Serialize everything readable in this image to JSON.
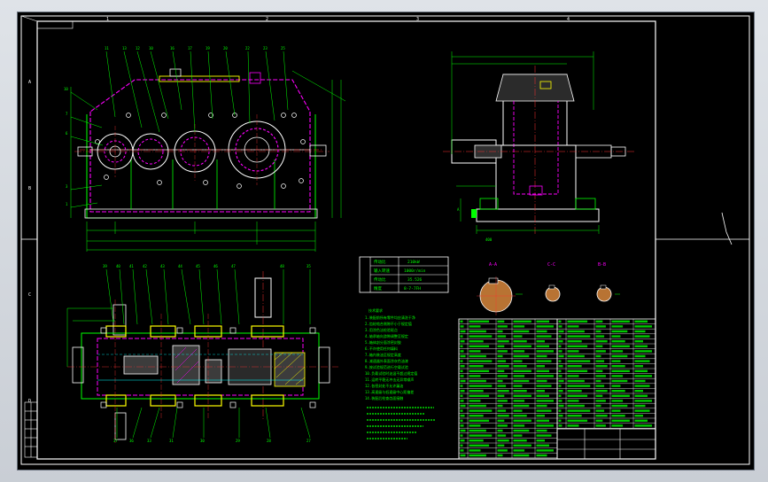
{
  "sheet": {
    "zone_numbers_top": [
      "1",
      "2",
      "3",
      "4"
    ],
    "zone_letters_side": [
      "A",
      "B",
      "C",
      "D"
    ]
  },
  "tech_table": {
    "rows": [
      {
        "label": "传动比",
        "value": "210kW"
      },
      {
        "label": "输入转速",
        "value": "1000r/min"
      },
      {
        "label": "传动比",
        "value": "35.526"
      },
      {
        "label": "精度",
        "value": "8-7-7FH"
      }
    ]
  },
  "sections": [
    {
      "label": "A-A"
    },
    {
      "label": "C-C"
    },
    {
      "label": "B-B"
    }
  ],
  "notes": {
    "title": "技术要求",
    "lines": [
      "1.装配前所有零件均应清洗干净",
      "2.齿轮啮合侧隙不小于规定值",
      "3.用涂色法检验斑点",
      "4.轴承轴向游隙调整至规定",
      "5.箱体剖分面涂密封胶",
      "6.不许使用任何填料",
      "7.箱内装油至规定高度",
      "8.减速器外表面涂灰色油漆",
      "9.按试验规范进行空载试验",
      "10.负载试验时油温不超过规定值",
      "11.运转平稳无冲击无异常噪声",
      "12.各密封处不允许漏油",
      "13.高速级与低速级中心距偏差",
      "14.装配后检查齿面接触"
    ]
  },
  "colors": {
    "green": "#00ff00",
    "white": "#ffffff",
    "magenta": "#ff00ff",
    "yellow": "#ffff00",
    "red": "#ff3030",
    "cyan": "#00ffff"
  }
}
